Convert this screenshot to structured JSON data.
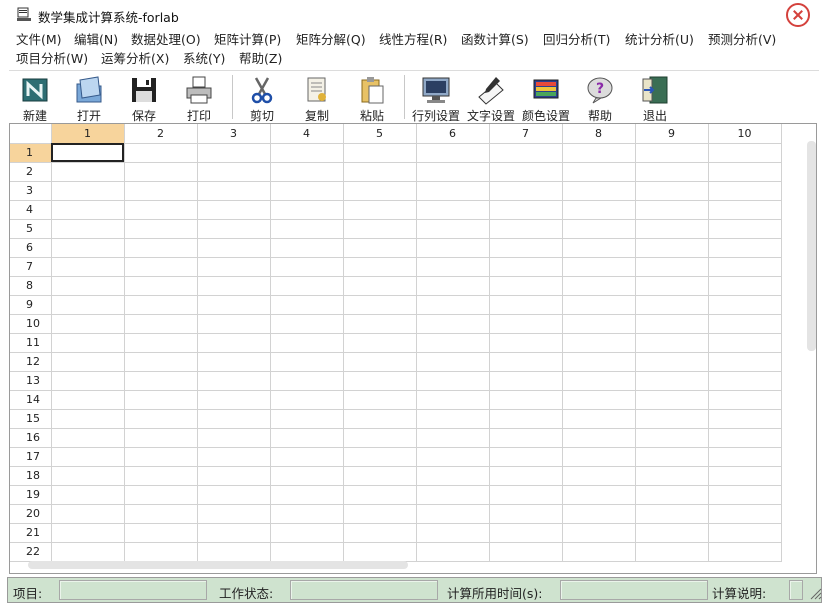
{
  "window": {
    "title": "数学集成计算系统-forlab"
  },
  "menu": [
    "文件(M)",
    "编辑(N)",
    "数据处理(O)",
    "矩阵计算(P)",
    "矩阵分解(Q)",
    "线性方程(R)",
    "函数计算(S)",
    "回归分析(T)",
    "统计分析(U)",
    "预测分析(V)",
    "项目分析(W)",
    "运筹分析(X)",
    "系统(Y)",
    "帮助(Z)"
  ],
  "toolbar": [
    {
      "label": "新建",
      "icon": "new-file-icon"
    },
    {
      "label": "打开",
      "icon": "folder-open-icon"
    },
    {
      "label": "保存",
      "icon": "floppy-disk-icon"
    },
    {
      "label": "打印",
      "icon": "printer-icon"
    },
    {
      "label": "剪切",
      "icon": "scissors-icon"
    },
    {
      "label": "复制",
      "icon": "copy-icon"
    },
    {
      "label": "粘贴",
      "icon": "paste-icon"
    },
    {
      "label": "行列设置",
      "icon": "row-col-settings-icon"
    },
    {
      "label": "文字设置",
      "icon": "text-settings-icon"
    },
    {
      "label": "颜色设置",
      "icon": "color-settings-icon"
    },
    {
      "label": "帮助",
      "icon": "help-icon"
    },
    {
      "label": "退出",
      "icon": "exit-door-icon"
    }
  ],
  "grid": {
    "columns": [
      "1",
      "2",
      "3",
      "4",
      "5",
      "6",
      "7",
      "8",
      "9",
      "10"
    ],
    "rows": [
      "1",
      "2",
      "3",
      "4",
      "5",
      "6",
      "7",
      "8",
      "9",
      "10",
      "11",
      "12",
      "13",
      "14",
      "15",
      "16",
      "17",
      "18",
      "19",
      "20",
      "21",
      "22"
    ],
    "active_row": "1",
    "active_col": "1"
  },
  "status": {
    "project_label": "项目:",
    "state_label": "工作状态:",
    "time_label": "计算所用时间(s):",
    "note_label": "计算说明:"
  },
  "colors": {
    "selected_header": "#f7d49c",
    "status_bg": "#cfe3cf",
    "close": "#d4413c"
  }
}
